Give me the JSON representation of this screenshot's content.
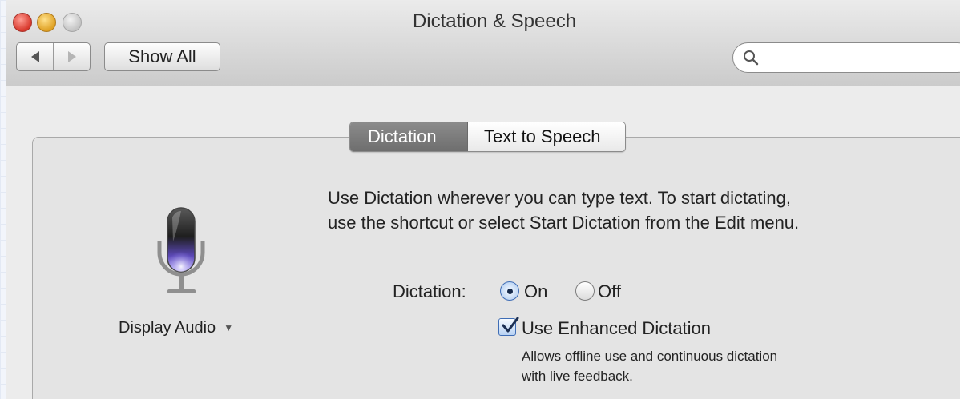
{
  "window": {
    "title": "Dictation & Speech"
  },
  "toolbar": {
    "show_all_label": "Show All",
    "search_placeholder": "",
    "search_value": ""
  },
  "tabs": [
    {
      "label": "Dictation",
      "selected": true
    },
    {
      "label": "Text to Speech",
      "selected": false
    }
  ],
  "mic": {
    "source_label": "Display Audio",
    "icon": "microphone-icon"
  },
  "description": {
    "line1": "Use Dictation wherever you can type text. To start dictating,",
    "line2": "use the shortcut or select Start Dictation from the Edit menu."
  },
  "dictation": {
    "label": "Dictation:",
    "on_label": "On",
    "off_label": "Off",
    "selected": "On"
  },
  "enhanced": {
    "label": "Use Enhanced Dictation",
    "checked": true,
    "hint_line1": "Allows offline use and continuous dictation",
    "hint_line2": "with live feedback."
  },
  "colors": {
    "close": "#e0443a",
    "minimize": "#e9b02c",
    "accent": "#3f6db5",
    "selected_tab": "#7b7b7b"
  }
}
